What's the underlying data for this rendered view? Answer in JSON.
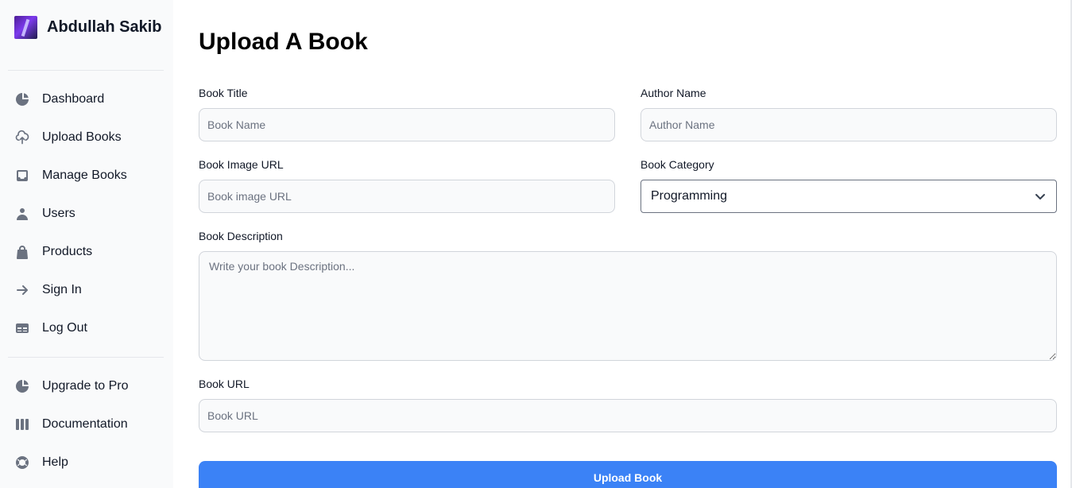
{
  "sidebar": {
    "user_name": "Abdullah Sakib",
    "items": [
      {
        "label": "Dashboard",
        "icon": "chart-pie-icon"
      },
      {
        "label": "Upload Books",
        "icon": "cloud-upload-icon"
      },
      {
        "label": "Manage Books",
        "icon": "inbox-icon"
      },
      {
        "label": "Users",
        "icon": "user-icon"
      },
      {
        "label": "Products",
        "icon": "shopping-bag-icon"
      },
      {
        "label": "Sign In",
        "icon": "arrow-right-icon"
      },
      {
        "label": "Log Out",
        "icon": "table-icon"
      }
    ],
    "secondary_items": [
      {
        "label": "Upgrade to Pro",
        "icon": "chart-pie-icon"
      },
      {
        "label": "Documentation",
        "icon": "view-boards-icon"
      },
      {
        "label": "Help",
        "icon": "support-icon"
      }
    ]
  },
  "form": {
    "title": "Upload A Book",
    "book_title": {
      "label": "Book Title",
      "placeholder": "Book Name"
    },
    "author_name": {
      "label": "Author Name",
      "placeholder": "Author Name"
    },
    "image_url": {
      "label": "Book Image URL",
      "placeholder": "Book image URL"
    },
    "category": {
      "label": "Book Category",
      "value": "Programming"
    },
    "description": {
      "label": "Book Description",
      "placeholder": "Write your book Description..."
    },
    "book_url": {
      "label": "Book URL",
      "placeholder": "Book URL"
    },
    "submit_label": "Upload Book"
  },
  "colors": {
    "accent": "#3b82f6",
    "sidebar_bg": "#f9fafb",
    "input_bg": "#f9fafb",
    "icon_gray": "#6b7280"
  }
}
